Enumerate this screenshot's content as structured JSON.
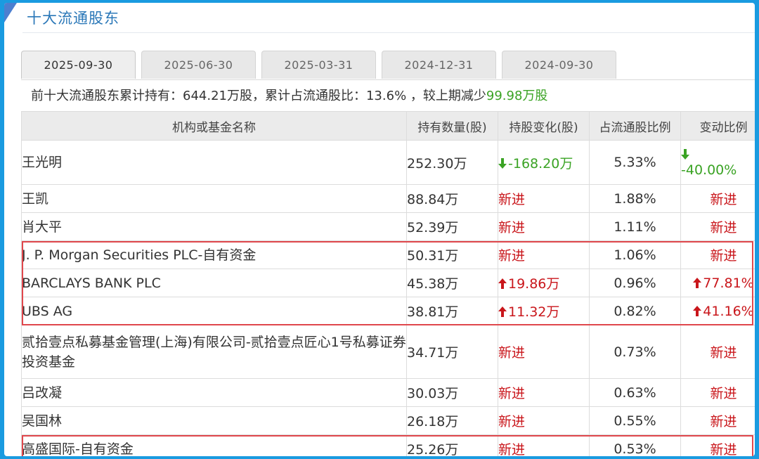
{
  "section": {
    "title": "十大流通股东"
  },
  "tabs": [
    "2025-09-30",
    "2025-06-30",
    "2025-03-31",
    "2024-12-31",
    "2024-09-30"
  ],
  "active_tab": "2025-09-30",
  "summary": {
    "prefix": "前十大流通股东累计持有：",
    "total": "644.21万股",
    "mid": "，累计占流通股比：",
    "ratio": "13.6%",
    "suffix": " ，较上期减少",
    "change": "99.98万股"
  },
  "table": {
    "headers": [
      "机构或基金名称",
      "持有数量(股)",
      "持股变化(股)",
      "占流通股比例",
      "变动比例"
    ],
    "rows": [
      {
        "name": "王光明",
        "qty": "252.30万",
        "change": "-168.20万",
        "change_dir": "down",
        "pct": "5.33%",
        "rate": "-40.00%",
        "rate_dir": "down"
      },
      {
        "name": "王凯",
        "qty": "88.84万",
        "change": "新进",
        "change_dir": "new",
        "pct": "1.88%",
        "rate": "新进",
        "rate_dir": "new"
      },
      {
        "name": "肖大平",
        "qty": "52.39万",
        "change": "新进",
        "change_dir": "new",
        "pct": "1.11%",
        "rate": "新进",
        "rate_dir": "new"
      },
      {
        "name": "J. P. Morgan Securities PLC-自有资金",
        "qty": "50.31万",
        "change": "新进",
        "change_dir": "new",
        "pct": "1.06%",
        "rate": "新进",
        "rate_dir": "new"
      },
      {
        "name": "BARCLAYS BANK PLC",
        "qty": "45.38万",
        "change": "19.86万",
        "change_dir": "up",
        "pct": "0.96%",
        "rate": "77.81%",
        "rate_dir": "up"
      },
      {
        "name": "UBS AG",
        "qty": "38.81万",
        "change": "11.32万",
        "change_dir": "up",
        "pct": "0.82%",
        "rate": "41.16%",
        "rate_dir": "up"
      },
      {
        "name": "贰拾壹点私募基金管理(上海)有限公司-贰拾壹点匠心1号私募证券投资基金",
        "qty": "34.71万",
        "change": "新进",
        "change_dir": "new",
        "pct": "0.73%",
        "rate": "新进",
        "rate_dir": "new"
      },
      {
        "name": "吕改凝",
        "qty": "30.03万",
        "change": "新进",
        "change_dir": "new",
        "pct": "0.63%",
        "rate": "新进",
        "rate_dir": "new"
      },
      {
        "name": "吴国林",
        "qty": "26.18万",
        "change": "新进",
        "change_dir": "new",
        "pct": "0.55%",
        "rate": "新进",
        "rate_dir": "new"
      },
      {
        "name": "高盛国际-自有资金",
        "qty": "25.26万",
        "change": "新进",
        "change_dir": "new",
        "pct": "0.53%",
        "rate": "新进",
        "rate_dir": "new"
      }
    ]
  },
  "colors": {
    "up": "#c9161b",
    "down": "#3aa324",
    "highlight": "#e0474c",
    "title": "#2b78b8"
  },
  "icons": {
    "up": "arrow-up-icon",
    "down": "arrow-down-icon"
  }
}
